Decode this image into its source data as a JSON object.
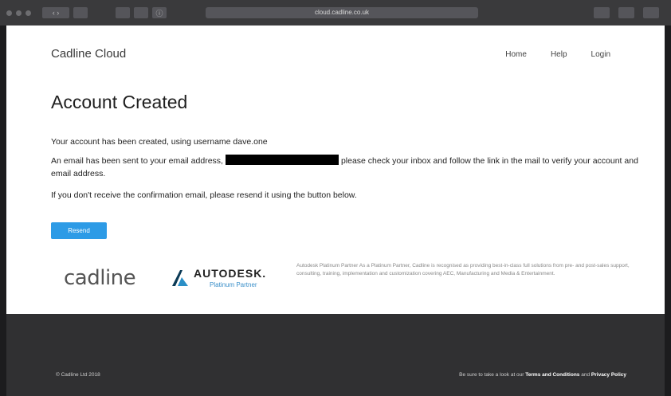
{
  "browser": {
    "address": "cloud.cadline.co.uk"
  },
  "header": {
    "brand": "Cadline Cloud",
    "nav": [
      "Home",
      "Help",
      "Login"
    ]
  },
  "main": {
    "title": "Account Created",
    "line1": "Your account has been created, using username dave.one",
    "line2_before": "An email has been sent to your email address,",
    "line2_after": "please check your inbox and follow the link in the mail to verify your account and email address.",
    "line3": "If you don't receive the confirmation email, please resend it using the button below.",
    "resend_label": "Resend"
  },
  "partners": {
    "cadline_logo": "cadline",
    "autodesk_name": "AUTODESK.",
    "autodesk_partner": "Platinum Partner",
    "partner_text": "Autodesk Platinum Partner As a Platinum Partner, Cadline is recognised as providing best-in-class full solutions from pre- and post-sales support, consulting, training, implementation and customization covering AEC, Manufacturing and Media & Entertainment."
  },
  "footer": {
    "copyright": "© Cadline Ltd 2018",
    "legal_prefix": "Be sure to take a look at our",
    "terms": "Terms and Conditions",
    "and": "and",
    "privacy": "Privacy Policy"
  },
  "colors": {
    "accent": "#2d9be6",
    "footer_bg": "#303032",
    "chrome_bg": "#3a3a3c"
  }
}
